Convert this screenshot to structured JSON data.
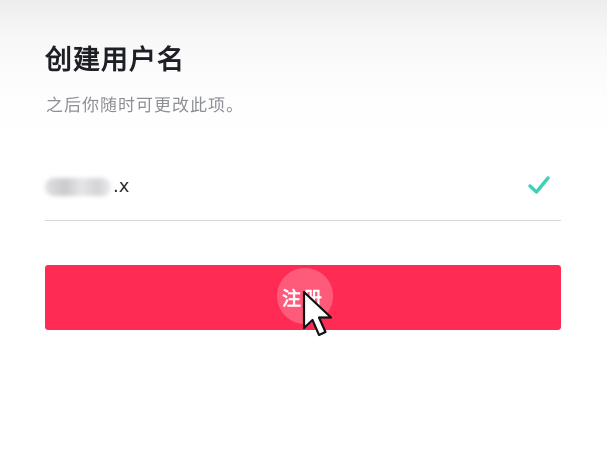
{
  "header": {
    "title": "创建用户名",
    "subtitle": "之后你随时可更改此项。"
  },
  "username_field": {
    "value_suffix": ".x",
    "valid_icon": "check-icon",
    "valid_color": "#3fd1b6"
  },
  "register_button": {
    "label": "注册",
    "color": "#fe2c55"
  },
  "pointer": {
    "icon": "mouse-cursor-icon"
  }
}
